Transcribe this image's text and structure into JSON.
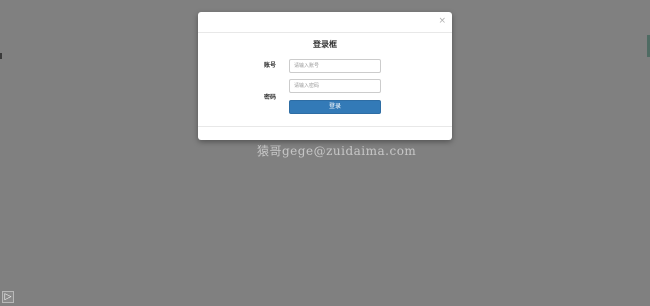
{
  "modal": {
    "close_symbol": "×",
    "title": "登录框",
    "account": {
      "label": "账号",
      "placeholder": "请输入账号"
    },
    "password": {
      "label": "密码",
      "placeholder": "请输入密码"
    },
    "login_button": "登录"
  },
  "watermark": "猿哥gege@zuidaima.com",
  "corner_toggle_symbol": "▷",
  "colors": {
    "backdrop": "#808080",
    "primary_button": "#337ab7",
    "modal_background": "#ffffff"
  },
  "icons": {
    "close": "close-icon",
    "corner_toggle": "expand-arrow-icon"
  }
}
